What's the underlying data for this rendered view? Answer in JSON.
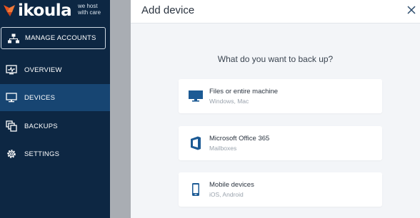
{
  "brand": {
    "name": "ikoula",
    "tagline_line1": "we host",
    "tagline_line2": "with care",
    "accent": "#e8531f"
  },
  "sidebar": {
    "manage_accounts": {
      "label": "MANAGE ACCOUNTS",
      "icon": "org-chart-icon"
    },
    "items": [
      {
        "label": "OVERVIEW",
        "icon": "pulse-monitor-icon",
        "active": false
      },
      {
        "label": "DEVICES",
        "icon": "desktop-icon",
        "active": true
      },
      {
        "label": "BACKUPS",
        "icon": "copies-icon",
        "active": false
      },
      {
        "label": "SETTINGS",
        "icon": "gear-icon",
        "active": false
      }
    ]
  },
  "panel": {
    "title": "Add device",
    "question": "What do you want to back up?",
    "options": [
      {
        "title": "Files or entire machine",
        "subtitle": "Windows, Mac",
        "icon": "monitor-icon"
      },
      {
        "title": "Microsoft Office 365",
        "subtitle": "Mailboxes",
        "icon": "office-icon"
      },
      {
        "title": "Mobile devices",
        "subtitle": "iOS, Android",
        "icon": "smartphone-icon"
      }
    ]
  },
  "colors": {
    "sidebar_bg": "#0d2743",
    "active_bg": "#174572",
    "icon_blue": "#1c5a94"
  }
}
